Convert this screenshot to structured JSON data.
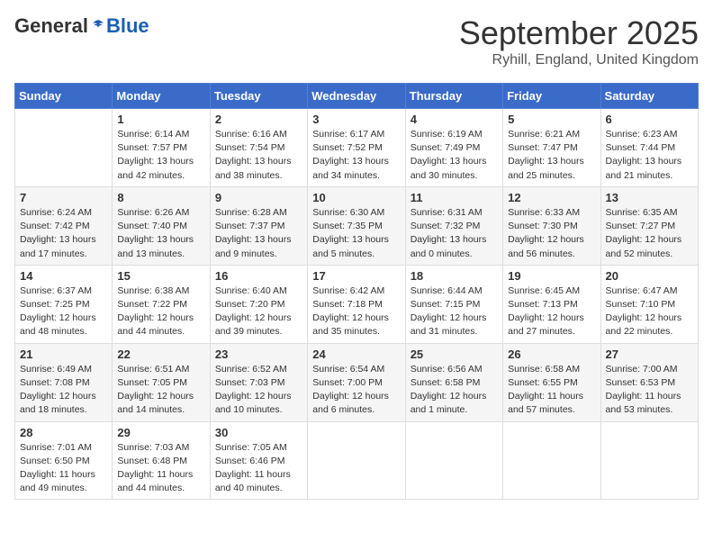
{
  "header": {
    "logo_general": "General",
    "logo_blue": "Blue",
    "month": "September 2025",
    "location": "Ryhill, England, United Kingdom"
  },
  "columns": [
    "Sunday",
    "Monday",
    "Tuesday",
    "Wednesday",
    "Thursday",
    "Friday",
    "Saturday"
  ],
  "weeks": [
    [
      {
        "day": "",
        "detail": ""
      },
      {
        "day": "1",
        "detail": "Sunrise: 6:14 AM\nSunset: 7:57 PM\nDaylight: 13 hours\nand 42 minutes."
      },
      {
        "day": "2",
        "detail": "Sunrise: 6:16 AM\nSunset: 7:54 PM\nDaylight: 13 hours\nand 38 minutes."
      },
      {
        "day": "3",
        "detail": "Sunrise: 6:17 AM\nSunset: 7:52 PM\nDaylight: 13 hours\nand 34 minutes."
      },
      {
        "day": "4",
        "detail": "Sunrise: 6:19 AM\nSunset: 7:49 PM\nDaylight: 13 hours\nand 30 minutes."
      },
      {
        "day": "5",
        "detail": "Sunrise: 6:21 AM\nSunset: 7:47 PM\nDaylight: 13 hours\nand 25 minutes."
      },
      {
        "day": "6",
        "detail": "Sunrise: 6:23 AM\nSunset: 7:44 PM\nDaylight: 13 hours\nand 21 minutes."
      }
    ],
    [
      {
        "day": "7",
        "detail": "Sunrise: 6:24 AM\nSunset: 7:42 PM\nDaylight: 13 hours\nand 17 minutes."
      },
      {
        "day": "8",
        "detail": "Sunrise: 6:26 AM\nSunset: 7:40 PM\nDaylight: 13 hours\nand 13 minutes."
      },
      {
        "day": "9",
        "detail": "Sunrise: 6:28 AM\nSunset: 7:37 PM\nDaylight: 13 hours\nand 9 minutes."
      },
      {
        "day": "10",
        "detail": "Sunrise: 6:30 AM\nSunset: 7:35 PM\nDaylight: 13 hours\nand 5 minutes."
      },
      {
        "day": "11",
        "detail": "Sunrise: 6:31 AM\nSunset: 7:32 PM\nDaylight: 13 hours\nand 0 minutes."
      },
      {
        "day": "12",
        "detail": "Sunrise: 6:33 AM\nSunset: 7:30 PM\nDaylight: 12 hours\nand 56 minutes."
      },
      {
        "day": "13",
        "detail": "Sunrise: 6:35 AM\nSunset: 7:27 PM\nDaylight: 12 hours\nand 52 minutes."
      }
    ],
    [
      {
        "day": "14",
        "detail": "Sunrise: 6:37 AM\nSunset: 7:25 PM\nDaylight: 12 hours\nand 48 minutes."
      },
      {
        "day": "15",
        "detail": "Sunrise: 6:38 AM\nSunset: 7:22 PM\nDaylight: 12 hours\nand 44 minutes."
      },
      {
        "day": "16",
        "detail": "Sunrise: 6:40 AM\nSunset: 7:20 PM\nDaylight: 12 hours\nand 39 minutes."
      },
      {
        "day": "17",
        "detail": "Sunrise: 6:42 AM\nSunset: 7:18 PM\nDaylight: 12 hours\nand 35 minutes."
      },
      {
        "day": "18",
        "detail": "Sunrise: 6:44 AM\nSunset: 7:15 PM\nDaylight: 12 hours\nand 31 minutes."
      },
      {
        "day": "19",
        "detail": "Sunrise: 6:45 AM\nSunset: 7:13 PM\nDaylight: 12 hours\nand 27 minutes."
      },
      {
        "day": "20",
        "detail": "Sunrise: 6:47 AM\nSunset: 7:10 PM\nDaylight: 12 hours\nand 22 minutes."
      }
    ],
    [
      {
        "day": "21",
        "detail": "Sunrise: 6:49 AM\nSunset: 7:08 PM\nDaylight: 12 hours\nand 18 minutes."
      },
      {
        "day": "22",
        "detail": "Sunrise: 6:51 AM\nSunset: 7:05 PM\nDaylight: 12 hours\nand 14 minutes."
      },
      {
        "day": "23",
        "detail": "Sunrise: 6:52 AM\nSunset: 7:03 PM\nDaylight: 12 hours\nand 10 minutes."
      },
      {
        "day": "24",
        "detail": "Sunrise: 6:54 AM\nSunset: 7:00 PM\nDaylight: 12 hours\nand 6 minutes."
      },
      {
        "day": "25",
        "detail": "Sunrise: 6:56 AM\nSunset: 6:58 PM\nDaylight: 12 hours\nand 1 minute."
      },
      {
        "day": "26",
        "detail": "Sunrise: 6:58 AM\nSunset: 6:55 PM\nDaylight: 11 hours\nand 57 minutes."
      },
      {
        "day": "27",
        "detail": "Sunrise: 7:00 AM\nSunset: 6:53 PM\nDaylight: 11 hours\nand 53 minutes."
      }
    ],
    [
      {
        "day": "28",
        "detail": "Sunrise: 7:01 AM\nSunset: 6:50 PM\nDaylight: 11 hours\nand 49 minutes."
      },
      {
        "day": "29",
        "detail": "Sunrise: 7:03 AM\nSunset: 6:48 PM\nDaylight: 11 hours\nand 44 minutes."
      },
      {
        "day": "30",
        "detail": "Sunrise: 7:05 AM\nSunset: 6:46 PM\nDaylight: 11 hours\nand 40 minutes."
      },
      {
        "day": "",
        "detail": ""
      },
      {
        "day": "",
        "detail": ""
      },
      {
        "day": "",
        "detail": ""
      },
      {
        "day": "",
        "detail": ""
      }
    ]
  ]
}
